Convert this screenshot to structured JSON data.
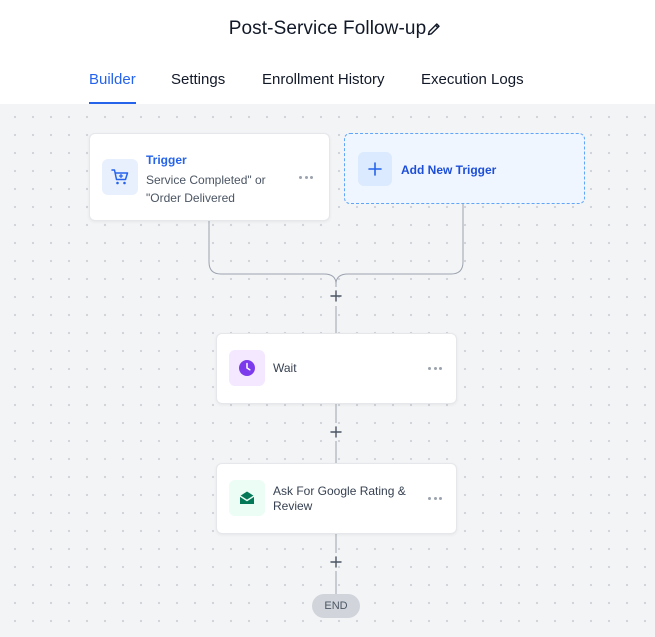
{
  "header": {
    "title": "Post-Service Follow-up",
    "edit_icon": "pencil-icon"
  },
  "tabs": [
    {
      "label": "Builder",
      "active": true
    },
    {
      "label": "Settings",
      "active": false
    },
    {
      "label": "Enrollment History",
      "active": false
    },
    {
      "label": "Execution Logs",
      "active": false
    }
  ],
  "trigger": {
    "label": "Trigger",
    "description": "Service Completed\" or \"Order Delivered",
    "icon": "cart-icon"
  },
  "add_trigger": {
    "label": "Add New Trigger",
    "icon": "plus-icon"
  },
  "steps": [
    {
      "label": "Wait",
      "icon": "clock-icon"
    },
    {
      "label": "Ask For Google Rating & Review",
      "icon": "email-icon"
    }
  ],
  "end_label": "END",
  "colors": {
    "accent": "#2563eb",
    "wait_icon": "#7c3aed",
    "email_icon": "#047857",
    "canvas_bg": "#f3f4f6"
  }
}
